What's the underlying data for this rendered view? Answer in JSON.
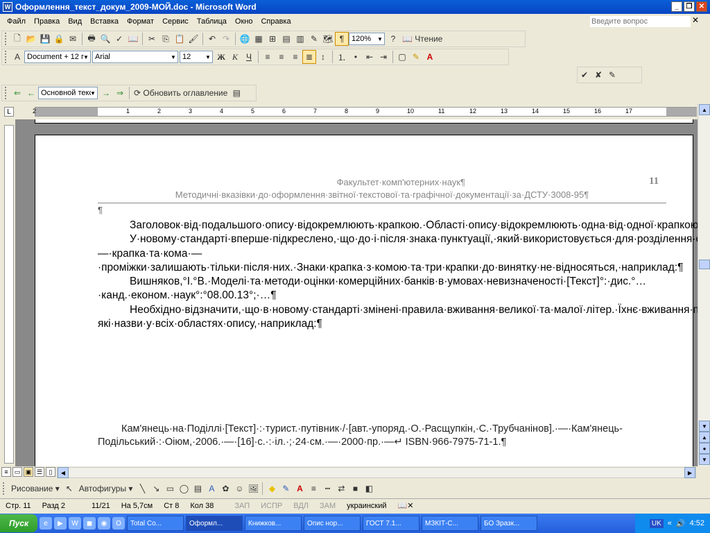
{
  "window": {
    "title": "Оформлення_текст_докум_2009-МОЙ.doc - Microsoft Word"
  },
  "menu": [
    "Файл",
    "Правка",
    "Вид",
    "Вставка",
    "Формат",
    "Сервис",
    "Таблица",
    "Окно",
    "Справка"
  ],
  "help_placeholder": "Введите вопрос",
  "toolbar": {
    "zoom": "120%",
    "read_label": "Чтение",
    "style": "Document + 12 г",
    "font": "Arial",
    "size": "12"
  },
  "outline": {
    "level": "Основной текст",
    "update_toc": "Обновить оглавление"
  },
  "ruler_numbers": [
    "2",
    "1",
    "1",
    "2",
    "3",
    "4",
    "5",
    "6",
    "7",
    "8",
    "9",
    "10",
    "11",
    "12",
    "13",
    "14",
    "15",
    "16",
    "17"
  ],
  "doc": {
    "header1": "Факультет·комп'ютерних·наук¶",
    "header2": "Методичні·вказівки·до·оформлення·звітної·текстової·та·графічної·документації·за·ДСТУ·3008-95¶",
    "page_number": "11",
    "empty_para": "¶",
    "paragraphs": [
      "Заголовок·від·подальшого·опису·відокремлюють·крапкою.·Області·опису·відокремлюють·одна·від·одної·крапкою·і·тире.·При·повторенні·окремих·областей·повторюють·крапку·і·тире.··¶",
      "У·новому·стандарті·вперше·підкреслено,·що·до·і·після·знака·пунктуації,·який·використовується·для·розділення·областей·бібліографічного·опису,·застосовують·проміжок·в·один·друкований·знак.·Виняток·—·крапка·та·кома·—·проміжки·залишають·тільки·після·них.·Знаки·крапка·з·комою·та·три·крапки·до·винятку·не·відносяться,·наприклад:¶",
      "Вишняков,°І.°В.·Моделі·та·методи·оцінки·комерційних·банків·в·умовах·невизначеності·[Текст]°:·дис.°…·канд.·економ.·наук°:°08.00.13°;·…¶",
      "Необхідно·відзначити,·що·в·новому·стандарті·змінені·правила·вживання·великої·та·малої·літер.·Їхнє·вживання·продиктоване·тепер·не·тільки·нормами·мови,·а·й·розділенням·областей·бібліографічного·опису.·Перші·слова·відомостей,·що·відносяться·до·назви·та·відомостей·про·відповідальність·записуються·з·малої·літери,·якщо·вони·не·є·власними·назвами,·першими·словами·назви·чи·цитатами.·Винятком·є·загальне·позначення·матеріалу·та·будь-які·назви·у·всіх·областях·опису,·наприклад:¶"
    ],
    "biblio": "Кам'янець·на·Поділлі·[Текст]·:·турист.·путівник·/·[авт.-упоряд.·О.·Расщупкін,·С.·Трубчанінов].·—·Кам'янець-Подільський·:·Оіюм,·2006.·—·[16]·с.·:·іл.·;·24·см.·—·2000·пр.·—↵ ISBN·966-7975-71-1.¶"
  },
  "drawing": {
    "draw_label": "Рисование",
    "autoshapes_label": "Автофигуры"
  },
  "status": [
    "Стр. 11",
    "Разд 2",
    "11/21",
    "На 5,7см",
    "Ст 8",
    "Кол 38"
  ],
  "status_modes": [
    "ЗАП",
    "ИСПР",
    "ВДЛ",
    "ЗАМ"
  ],
  "status_lang": "украинский",
  "taskbar": {
    "start": "Пуск",
    "items": [
      "Total Co...",
      "Оформл...",
      "Книжков...",
      "Опис нор...",
      "ГОСТ 7.1...",
      "МЗКІТ-С...",
      "БО Зразк..."
    ],
    "lang": "UK",
    "clock": "4:52"
  }
}
